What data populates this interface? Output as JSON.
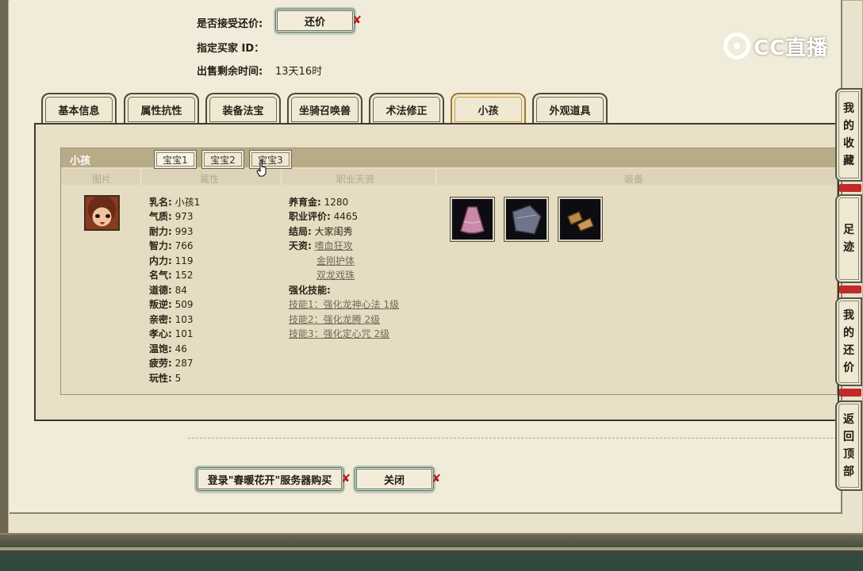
{
  "header": {
    "counter_offer_label": "是否接受还价:",
    "counter_offer_button": "还价",
    "buyer_id_label": "指定买家 ID：",
    "time_left_label": "出售剩余时间:",
    "time_left_value": "13天16时"
  },
  "logo": {
    "text": "CC直播"
  },
  "tabs": [
    "基本信息",
    "属性抗性",
    "装备法宝",
    "坐骑召唤兽",
    "术法修正",
    "小孩",
    "外观道具"
  ],
  "active_tab": "小孩",
  "child_panel": {
    "title": "小孩",
    "baby_tabs": [
      "宝宝1",
      "宝宝2",
      "宝宝3"
    ],
    "active_baby_tab": "宝宝1",
    "columns": [
      "图片",
      "属性",
      "职业天资",
      "装备"
    ],
    "attributes": [
      {
        "key": "乳名",
        "value": "小孩1"
      },
      {
        "key": "气质",
        "value": "973"
      },
      {
        "key": "耐力",
        "value": "993"
      },
      {
        "key": "智力",
        "value": "766"
      },
      {
        "key": "内力",
        "value": "119"
      },
      {
        "key": "名气",
        "value": "152"
      },
      {
        "key": "道德",
        "value": "84"
      },
      {
        "key": "叛逆",
        "value": "509"
      },
      {
        "key": "亲密",
        "value": "103"
      },
      {
        "key": "孝心",
        "value": "101"
      },
      {
        "key": "温饱",
        "value": "46"
      },
      {
        "key": "疲劳",
        "value": "287"
      },
      {
        "key": "玩性",
        "value": "5"
      }
    ],
    "career": {
      "upbringing_key": "养育金",
      "upbringing_value": "1280",
      "rating_key": "职业评价",
      "rating_value": "4465",
      "ending_key": "结局",
      "ending_value": "大家闺秀",
      "talent_key": "天资",
      "talents": [
        "嗜血狂攻",
        "金刚护体",
        "双龙戏珠"
      ],
      "skills_title": "强化技能:",
      "skills": [
        "技能1：强化龙神心法 1级",
        "技能2：强化龙腾 2级",
        "技能3：强化定心咒 2级"
      ]
    },
    "equipment": [
      "pink-skirt",
      "gray-clothes",
      "brown-shoes"
    ]
  },
  "footer": {
    "buy_button": "登录\"春暖花开\"服务器购买",
    "close_button": "关闭"
  },
  "side_nav": [
    {
      "chars": [
        "我",
        "的",
        "收",
        "藏"
      ]
    },
    {
      "chars": [
        "足",
        "迹"
      ]
    },
    {
      "chars": [
        "我",
        "的",
        "还",
        "价"
      ]
    },
    {
      "chars": [
        "返",
        "回",
        "顶",
        "部"
      ]
    }
  ]
}
